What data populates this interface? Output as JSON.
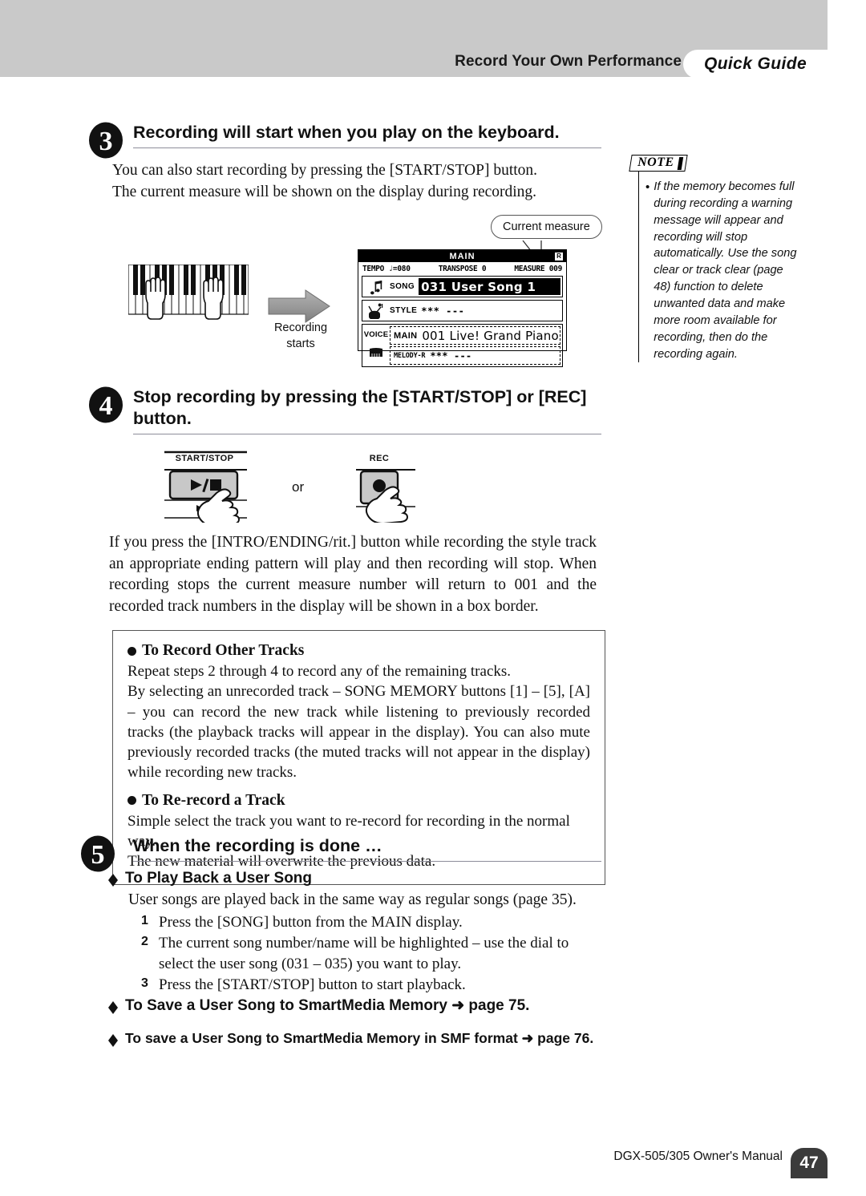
{
  "header": {
    "title": "Record Your Own Performance",
    "tab_label": "Quick Guide"
  },
  "steps": {
    "step3": {
      "number": "3",
      "heading": "Recording will start when you play on the keyboard.",
      "para_line1": "You can also start recording by pressing the [START/STOP] button.",
      "para_line2": "The current measure will be shown on the display during recording."
    },
    "step4": {
      "number": "4",
      "heading_line1": "Stop recording by pressing the [START/STOP] or [REC]",
      "heading_line2": "button.",
      "para": "If you press the [INTRO/ENDING/rit.] button while recording the style track an appropriate ending pattern will play and then recording will stop. When recording stops the current measure number will return to 001 and the recorded track numbers in the display will be shown in a box border."
    },
    "step5": {
      "number": "5",
      "heading": "When the recording is done …"
    }
  },
  "note": {
    "label": "NOTE",
    "bullet": "•",
    "text": "If the memory becomes full during recording a warning message will appear and recording will stop automatically. Use the song clear or track clear (page 48) function to delete unwanted data and make more room available for recording, then do the recording again."
  },
  "figure_record": {
    "recording_starts_line1": "Recording",
    "recording_starts_line2": "starts",
    "callout": "Current measure"
  },
  "lcd": {
    "title": "MAIN",
    "r_badge": "R",
    "tempo": "TEMPO ♩=080",
    "transpose": "TRANSPOSE 0",
    "measure": "MEASURE 009",
    "song_tag": "SONG",
    "song_value": "031 User Song 1",
    "style_tag": "STYLE",
    "style_value": "*** ---",
    "voice_tag": "VOICE",
    "voice_main_tag": "MAIN",
    "voice_main_value": "001 Live! Grand Piano",
    "voice_melody_tag": "MELODY-R",
    "voice_melody_value": "*** ---"
  },
  "panel_buttons": {
    "start_stop_caption": "START/STOP",
    "start_stop_glyph": "▶/■",
    "start_stop_sub_glyph": "▶/■",
    "or_label": "or",
    "rec_caption": "REC"
  },
  "info_box": {
    "section1_head": "To Record Other Tracks",
    "section1_p1": "Repeat steps 2 through 4 to record any of the remaining tracks.",
    "section1_p2": "By selecting an unrecorded track – SONG MEMORY buttons [1] – [5], [A] – you can record the new track while listening to previously recorded tracks (the playback tracks will appear in the display). You can also mute previously recorded tracks (the muted tracks will not appear in the display) while recording new tracks.",
    "section2_head": "To Re-record a Track",
    "section2_p1": "Simple select the track you want to re-record for recording in the normal way.",
    "section2_p2": "The new material will overwrite the previous data."
  },
  "playback": {
    "heading": "To Play Back a User Song",
    "intro": "User songs are played back in the same way as regular songs (page 35).",
    "items": [
      {
        "num": "1",
        "text": "Press the [SONG] button from the MAIN display."
      },
      {
        "num": "2",
        "text": "The current song number/name will be highlighted – use the dial to select the user song (031 – 035) you want to play."
      },
      {
        "num": "3",
        "text": "Press the [START/STOP] button to start playback."
      }
    ]
  },
  "save_links": [
    "To Save a User Song to SmartMedia Memory ➜ page 75.",
    "To save a User Song to SmartMedia Memory in SMF format ➜ page 76."
  ],
  "footer": {
    "text": "DGX-505/305  Owner's Manual",
    "page": "47"
  },
  "colors": {
    "header_band": "#c9c9c9",
    "rule": "#8d8d9a",
    "page_badge": "#3b3b3b"
  }
}
